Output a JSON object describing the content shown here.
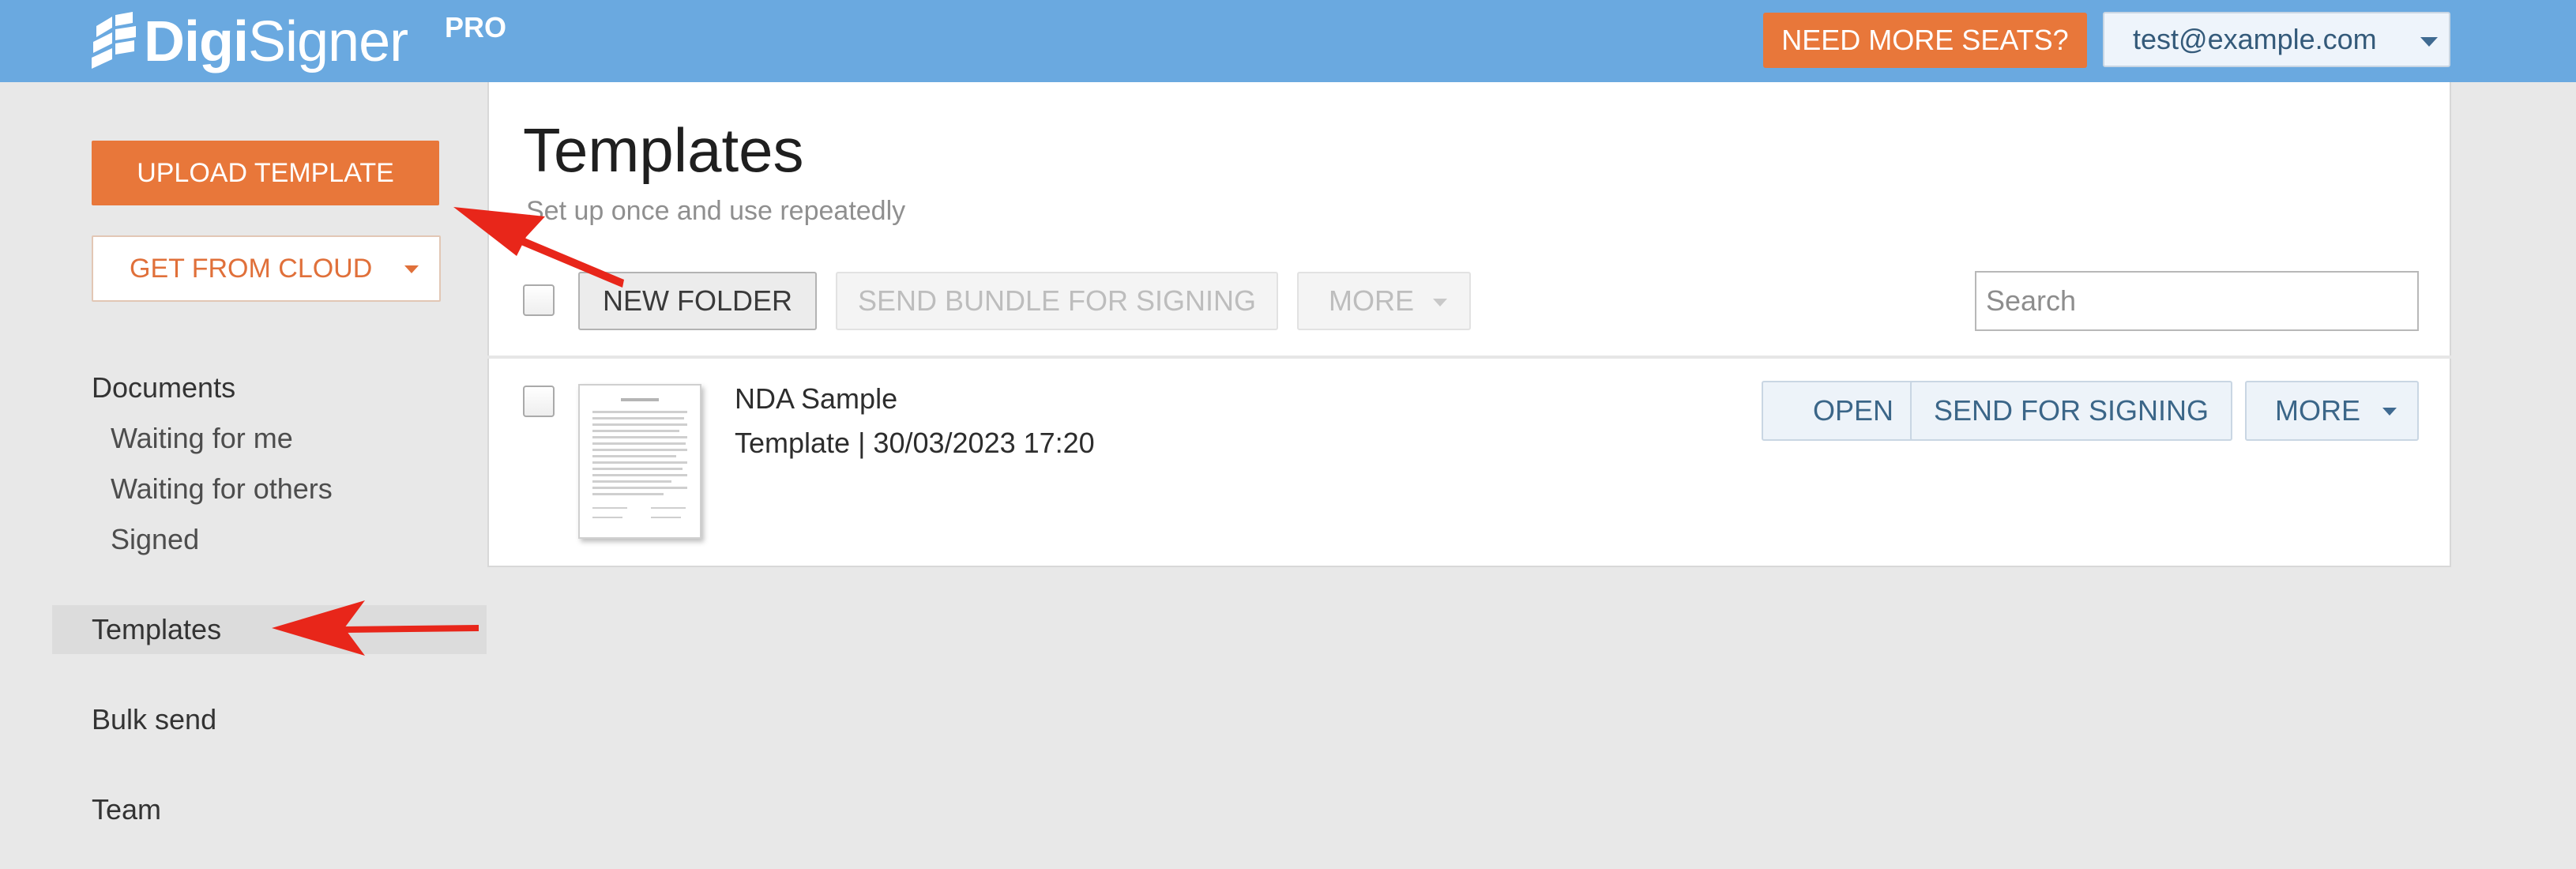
{
  "header": {
    "logo_text_bold": "Digi",
    "logo_text_regular": "Signer",
    "logo_badge": "PRO",
    "need_seats_label": "NEED MORE SEATS?",
    "user_email": "test@example.com"
  },
  "sidebar": {
    "upload_label": "UPLOAD TEMPLATE",
    "cloud_label": "GET FROM CLOUD",
    "nav": {
      "documents": "Documents",
      "waiting_for_me": "Waiting for me",
      "waiting_for_others": "Waiting for others",
      "signed": "Signed",
      "templates": "Templates",
      "bulk_send": "Bulk send",
      "team": "Team"
    },
    "active_item": "Templates"
  },
  "main": {
    "title": "Templates",
    "subtitle": "Set up once and use repeatedly",
    "toolbar": {
      "new_folder": "NEW FOLDER",
      "send_bundle": "SEND BUNDLE FOR SIGNING",
      "more": "MORE"
    },
    "search": {
      "placeholder": "Search",
      "value": ""
    },
    "items": [
      {
        "name": "NDA Sample",
        "meta": "Template | 30/03/2023 17:20",
        "actions": {
          "open": "OPEN",
          "send": "SEND FOR SIGNING",
          "more": "MORE"
        }
      }
    ]
  },
  "colors": {
    "header_bg": "#6aa9e0",
    "accent_orange": "#e8773a",
    "annotation_arrow": "#e8261a"
  }
}
